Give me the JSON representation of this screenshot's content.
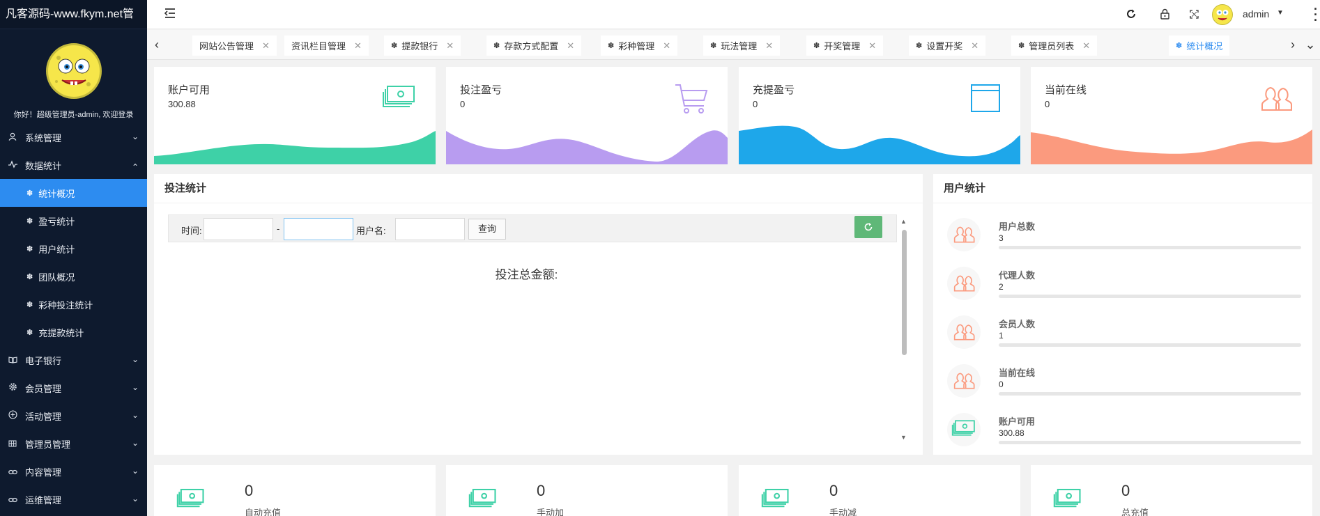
{
  "sidebar": {
    "brand": "凡客源码-www.fkym.net管",
    "greeting": "你好！超级管理员-admin, 欢迎登录",
    "menu": [
      {
        "label": "系统管理",
        "icon": "user-icon",
        "expanded": false
      },
      {
        "label": "数据统计",
        "icon": "pulse-icon",
        "expanded": true
      }
    ],
    "submenu": [
      {
        "label": "统计概况",
        "active": true
      },
      {
        "label": "盈亏统计",
        "active": false
      },
      {
        "label": "用户统计",
        "active": false
      },
      {
        "label": "团队概况",
        "active": false
      },
      {
        "label": "彩种投注统计",
        "active": false
      },
      {
        "label": "充提款统计",
        "active": false
      }
    ],
    "menu_after": [
      {
        "label": "电子银行",
        "icon": "book-icon"
      },
      {
        "label": "会员管理",
        "icon": "gear-icon"
      },
      {
        "label": "活动管理",
        "icon": "plus-circle-icon"
      },
      {
        "label": "管理员管理",
        "icon": "grid-icon"
      },
      {
        "label": "内容管理",
        "icon": "link-icon"
      },
      {
        "label": "运维管理",
        "icon": "link-icon"
      }
    ]
  },
  "topbar": {
    "username": "admin",
    "icons": [
      "menu-fold-icon",
      "refresh-icon",
      "lock-icon",
      "fullscreen-icon",
      "more-icon"
    ]
  },
  "tabs": [
    {
      "label": "网站公告管理",
      "icon": false,
      "active": false
    },
    {
      "label": "资讯栏目管理",
      "icon": false,
      "active": false
    },
    {
      "label": "提款银行",
      "icon": true,
      "active": false
    },
    {
      "label": "存款方式配置",
      "icon": true,
      "active": false
    },
    {
      "label": "彩种管理",
      "icon": true,
      "active": false
    },
    {
      "label": "玩法管理",
      "icon": true,
      "active": false
    },
    {
      "label": "开奖管理",
      "icon": true,
      "active": false
    },
    {
      "label": "设置开奖",
      "icon": true,
      "active": false
    },
    {
      "label": "管理员列表",
      "icon": true,
      "active": false
    },
    {
      "label": "统计概况",
      "icon": true,
      "active": true
    }
  ],
  "stat_cards": [
    {
      "title": "账户可用",
      "value": "300.88",
      "icon": "money-icon",
      "color": "#3ed1a7"
    },
    {
      "title": "投注盈亏",
      "value": "0",
      "icon": "cart-icon",
      "color": "#b89cf0"
    },
    {
      "title": "充提盈亏",
      "value": "0",
      "icon": "window-icon",
      "color": "#1ea7ea"
    },
    {
      "title": "当前在线",
      "value": "0",
      "icon": "users-icon",
      "color": "#fb9a7e"
    }
  ],
  "bet_panel": {
    "title": "投注统计",
    "time_label": "时间:",
    "dash": "-",
    "username_label": "用户名:",
    "query_button": "查询",
    "total_label": "投注总金额:"
  },
  "user_panel": {
    "title": "用户统计",
    "rows": [
      {
        "label": "用户总数",
        "value": "3",
        "icon": "users-icon"
      },
      {
        "label": "代理人数",
        "value": "2",
        "icon": "users-icon"
      },
      {
        "label": "会员人数",
        "value": "1",
        "icon": "users-icon"
      },
      {
        "label": "当前在线",
        "value": "0",
        "icon": "users-icon"
      },
      {
        "label": "账户可用",
        "value": "300.88",
        "icon": "money-icon"
      }
    ]
  },
  "bottom_cards": [
    {
      "value": "0",
      "label": "自动充值"
    },
    {
      "value": "0",
      "label": "手动加"
    },
    {
      "value": "0",
      "label": "手动减"
    },
    {
      "value": "0",
      "label": "总充值"
    }
  ],
  "colors": {
    "sidebar_bg": "#0e1a2e",
    "active_blue": "#2d8cf0",
    "green": "#5fb878",
    "money_green": "#3ed1a7",
    "user_orange": "#fb9a7e"
  }
}
